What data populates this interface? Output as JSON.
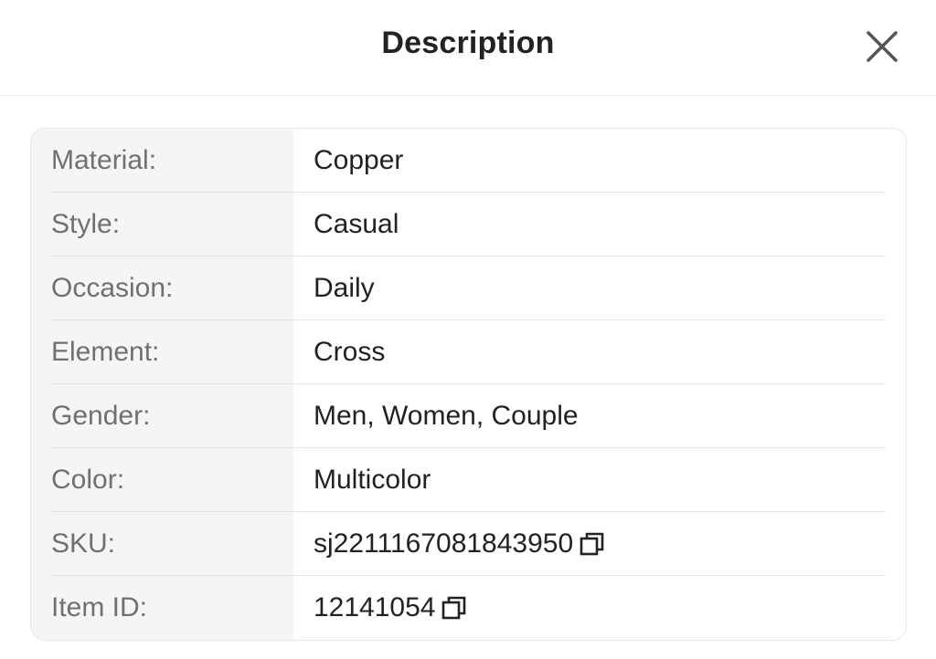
{
  "header": {
    "title": "Description",
    "close_icon": "close-icon"
  },
  "details": [
    {
      "label": "Material:",
      "value": "Copper",
      "copyable": false
    },
    {
      "label": "Style:",
      "value": "Casual",
      "copyable": false
    },
    {
      "label": "Occasion:",
      "value": "Daily",
      "copyable": false
    },
    {
      "label": "Element:",
      "value": "Cross",
      "copyable": false
    },
    {
      "label": "Gender:",
      "value": "Men, Women, Couple",
      "copyable": false
    },
    {
      "label": "Color:",
      "value": "Multicolor",
      "copyable": false
    },
    {
      "label": "SKU:",
      "value": "sj2211167081843950",
      "copyable": true
    },
    {
      "label": "Item ID:",
      "value": "12141054",
      "copyable": true
    }
  ],
  "icons": {
    "copy": "copy-icon"
  },
  "colors": {
    "label_text": "#707070",
    "value_text": "#222222",
    "label_column_bg": "#f5f5f5",
    "divider": "#e3e3e3"
  }
}
